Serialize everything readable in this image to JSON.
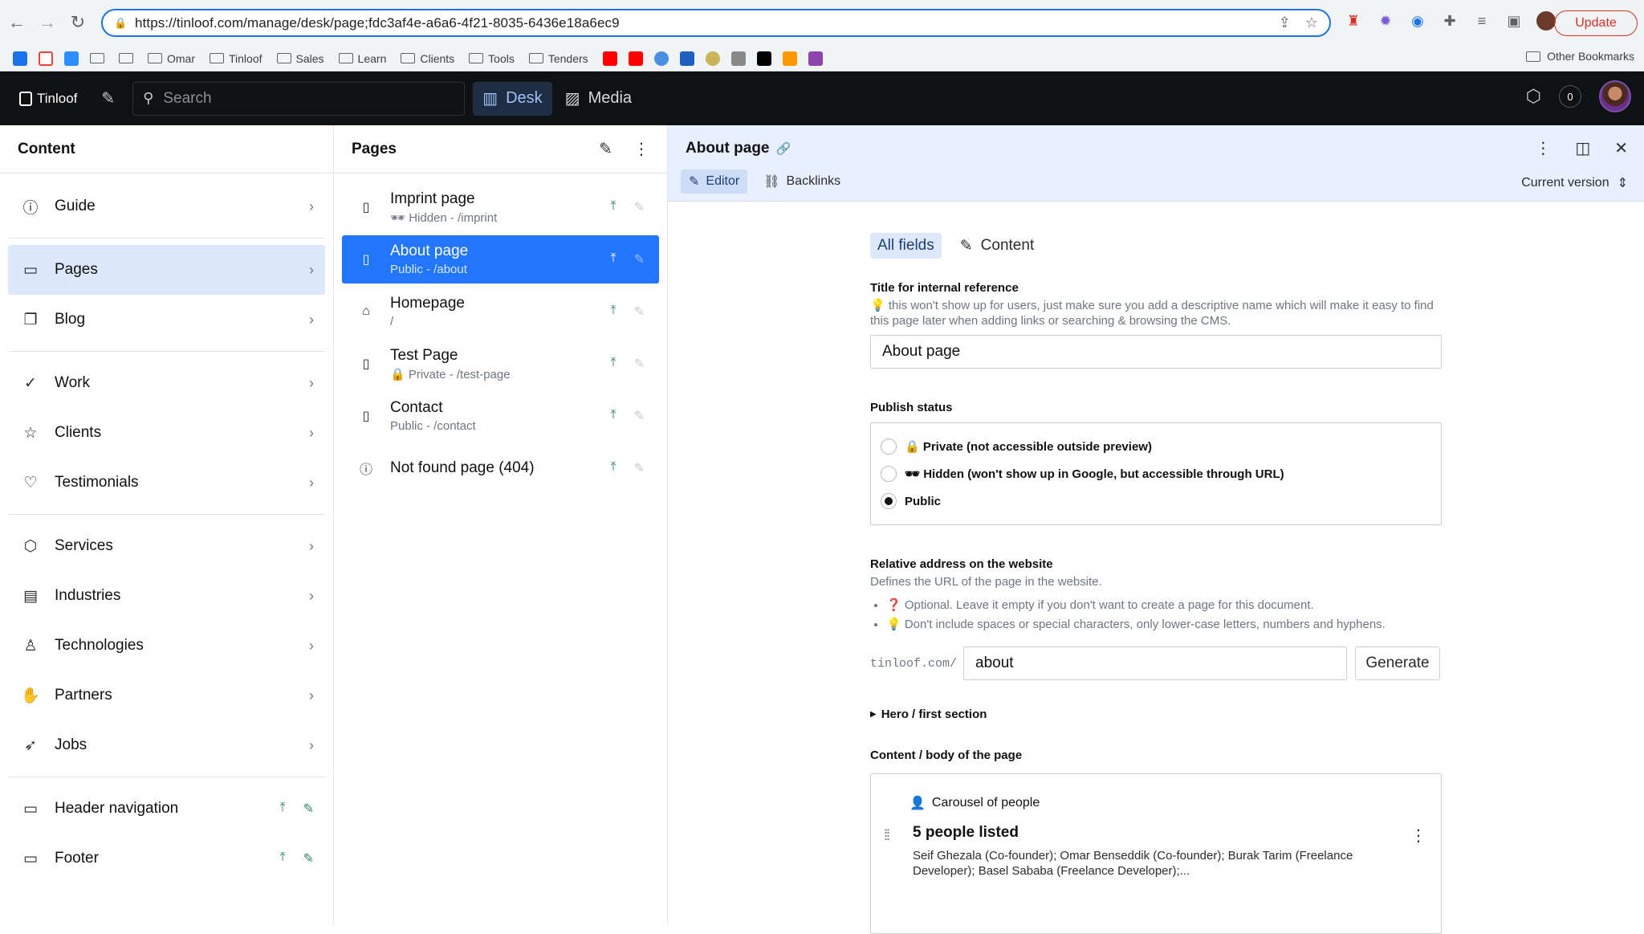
{
  "browser": {
    "url": "https://tinloof.com/manage/desk/page;fdc3af4e-a6a6-4f21-8035-6436e18a6ec9",
    "update_label": "Update",
    "bookmarks": [
      "Omar",
      "Tinloof",
      "Sales",
      "Learn",
      "Clients",
      "Tools",
      "Tenders"
    ],
    "other_bookmarks": "Other Bookmarks"
  },
  "studio": {
    "logo": "Tinloof",
    "search_placeholder": "Search",
    "tools": {
      "desk": "Desk",
      "media": "Media"
    },
    "notification_count": "0"
  },
  "content_pane": {
    "title": "Content",
    "items": [
      {
        "label": "Guide"
      },
      {
        "label": "Pages"
      },
      {
        "label": "Blog"
      },
      {
        "label": "Work"
      },
      {
        "label": "Clients"
      },
      {
        "label": "Testimonials"
      },
      {
        "label": "Services"
      },
      {
        "label": "Industries"
      },
      {
        "label": "Technologies"
      },
      {
        "label": "Partners"
      },
      {
        "label": "Jobs"
      },
      {
        "label": "Header navigation"
      },
      {
        "label": "Footer"
      }
    ]
  },
  "pages_pane": {
    "title": "Pages",
    "items": [
      {
        "title": "Imprint page",
        "sub": "🕶 Hidden - /imprint"
      },
      {
        "title": "About page",
        "sub": "Public - /about"
      },
      {
        "title": "Homepage",
        "sub": "/"
      },
      {
        "title": "Test Page",
        "sub": "🔒 Private - /test-page"
      },
      {
        "title": "Contact",
        "sub": "Public - /contact"
      },
      {
        "title": "Not found page (404)",
        "sub": ""
      }
    ]
  },
  "document": {
    "title": "About page",
    "tabs": {
      "editor": "Editor",
      "backlinks": "Backlinks"
    },
    "version": "Current version",
    "view_tabs": {
      "all": "All fields",
      "content": "Content"
    },
    "fields": {
      "internal_title": {
        "label": "Title for internal reference",
        "description": "💡 this won't show up for users, just make sure you add a descriptive name which will make it easy to find this page later when adding links or searching & browsing the CMS.",
        "value": "About page"
      },
      "publish_status": {
        "label": "Publish status",
        "options": [
          "🔒 Private (not accessible outside preview)",
          "🕶 Hidden (won't show up in Google, but accessible through URL)",
          "Public"
        ],
        "selected": "Public"
      },
      "slug": {
        "label": "Relative address on the website",
        "description": "Defines the URL of the page in the website.",
        "hints": [
          "❓ Optional. Leave it empty if you don't want to create a page for this document.",
          "💡 Don't include spaces or special characters, only lower-case letters, numbers and hyphens."
        ],
        "prefix": "tinloof.com/",
        "value": "about",
        "generate_label": "Generate"
      },
      "hero": {
        "label": "Hero / first section"
      },
      "body": {
        "label": "Content / body of the page",
        "block_type": "Carousel of people",
        "block_title": "5 people listed",
        "block_subtitle": "Seif Ghezala (Co-founder); Omar Benseddik (Co-founder); Burak Tarim (Freelance Developer); Basel Sababa (Freelance Developer);..."
      }
    }
  }
}
